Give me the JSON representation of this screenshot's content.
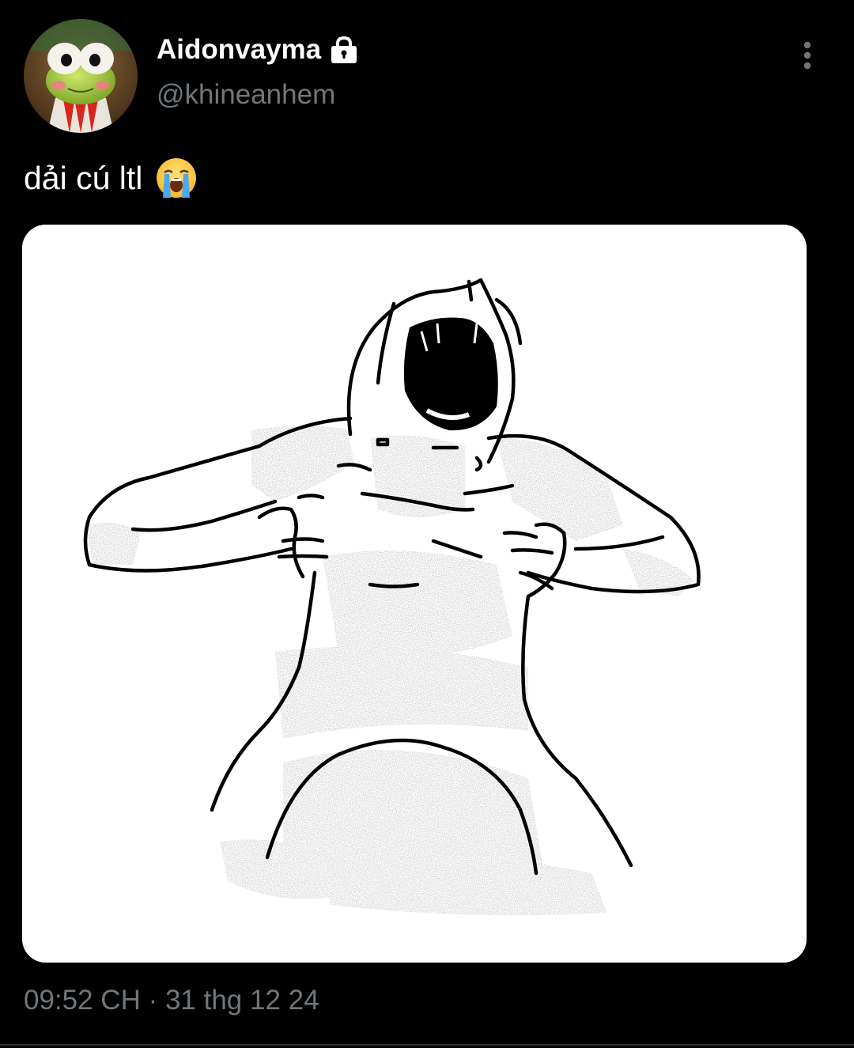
{
  "author": {
    "display_name": "Aidonvayma",
    "handle": "@khineanhem",
    "protected_icon": "lock-icon",
    "avatar_icon": "frog-avatar"
  },
  "menu": {
    "icon": "more-vertical-icon"
  },
  "tweet": {
    "text": "dải cú ltl",
    "emoji": "loudly-crying-face-emoji"
  },
  "media": {
    "icon": "meme-drawing-screaming-figure"
  },
  "meta": {
    "timestamp": "09:52 CH · 31 thg 12 24"
  },
  "colors": {
    "background": "#000000",
    "primary_text": "#ffffff",
    "secondary_text": "#71767b",
    "media_background": "#ffffff"
  }
}
